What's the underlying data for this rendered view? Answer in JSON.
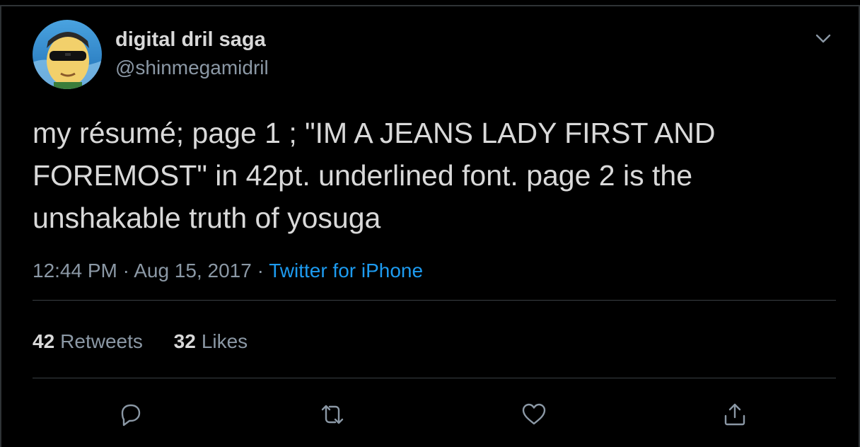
{
  "tweet": {
    "author_name": "digital dril saga",
    "author_handle": "@shinmegamidril",
    "text": "my résumé; page 1 ; \"IM A JEANS LADY FIRST AND\nFOREMOST\" in 42pt. underlined font. page 2 is the\nunshakable truth of yosuga",
    "time": "12:44 PM",
    "date": "Aug 15, 2017",
    "separator": "·",
    "source": "Twitter for iPhone",
    "retweets_count": "42",
    "retweets_label": "Retweets",
    "likes_count": "32",
    "likes_label": "Likes"
  },
  "icons": {
    "menu": "chevron-down-icon",
    "reply": "reply-icon",
    "retweet": "retweet-icon",
    "like": "like-icon",
    "share": "share-icon"
  },
  "colors": {
    "background": "#000000",
    "text": "#d9d9d9",
    "muted": "#8b98a5",
    "link": "#1d9bf0",
    "divider": "#3a3f44"
  }
}
